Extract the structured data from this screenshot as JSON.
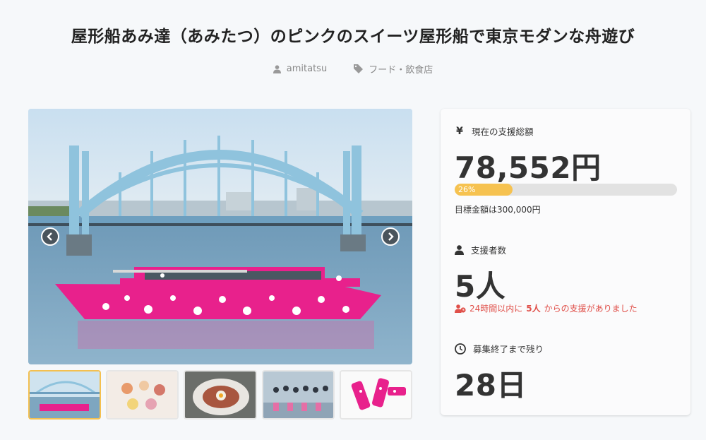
{
  "project": {
    "title": "屋形船あみ達（あみたつ）のピンクのスイーツ屋形船で東京モダンな舟遊び",
    "author": "amitatsu",
    "category": "フード・飲食店"
  },
  "gallery": {
    "thumbnail_count": 5,
    "active_index": 0
  },
  "stats": {
    "total_label": "現在の支援総額",
    "total_amount": "78,552円",
    "progress_percent": 26,
    "progress_label": "26%",
    "goal_text": "目標金額は300,000円",
    "backers_label": "支援者数",
    "backers_count": "5人",
    "recent_prefix": "24時間以内に",
    "recent_count": "5人",
    "recent_suffix": "からの支援がありました",
    "remaining_label": "募集終了まで残り",
    "remaining_value": "28日"
  },
  "icons": {
    "author": "user-icon",
    "category": "tag-icon",
    "total": "yen-icon",
    "backers": "person-icon",
    "recent": "user-clock-icon",
    "remaining": "clock-icon",
    "prev": "chevron-left-icon",
    "next": "chevron-right-icon"
  },
  "colors": {
    "accent": "#f6c250",
    "alert": "#e0504a",
    "boat_pink": "#e8218c"
  }
}
